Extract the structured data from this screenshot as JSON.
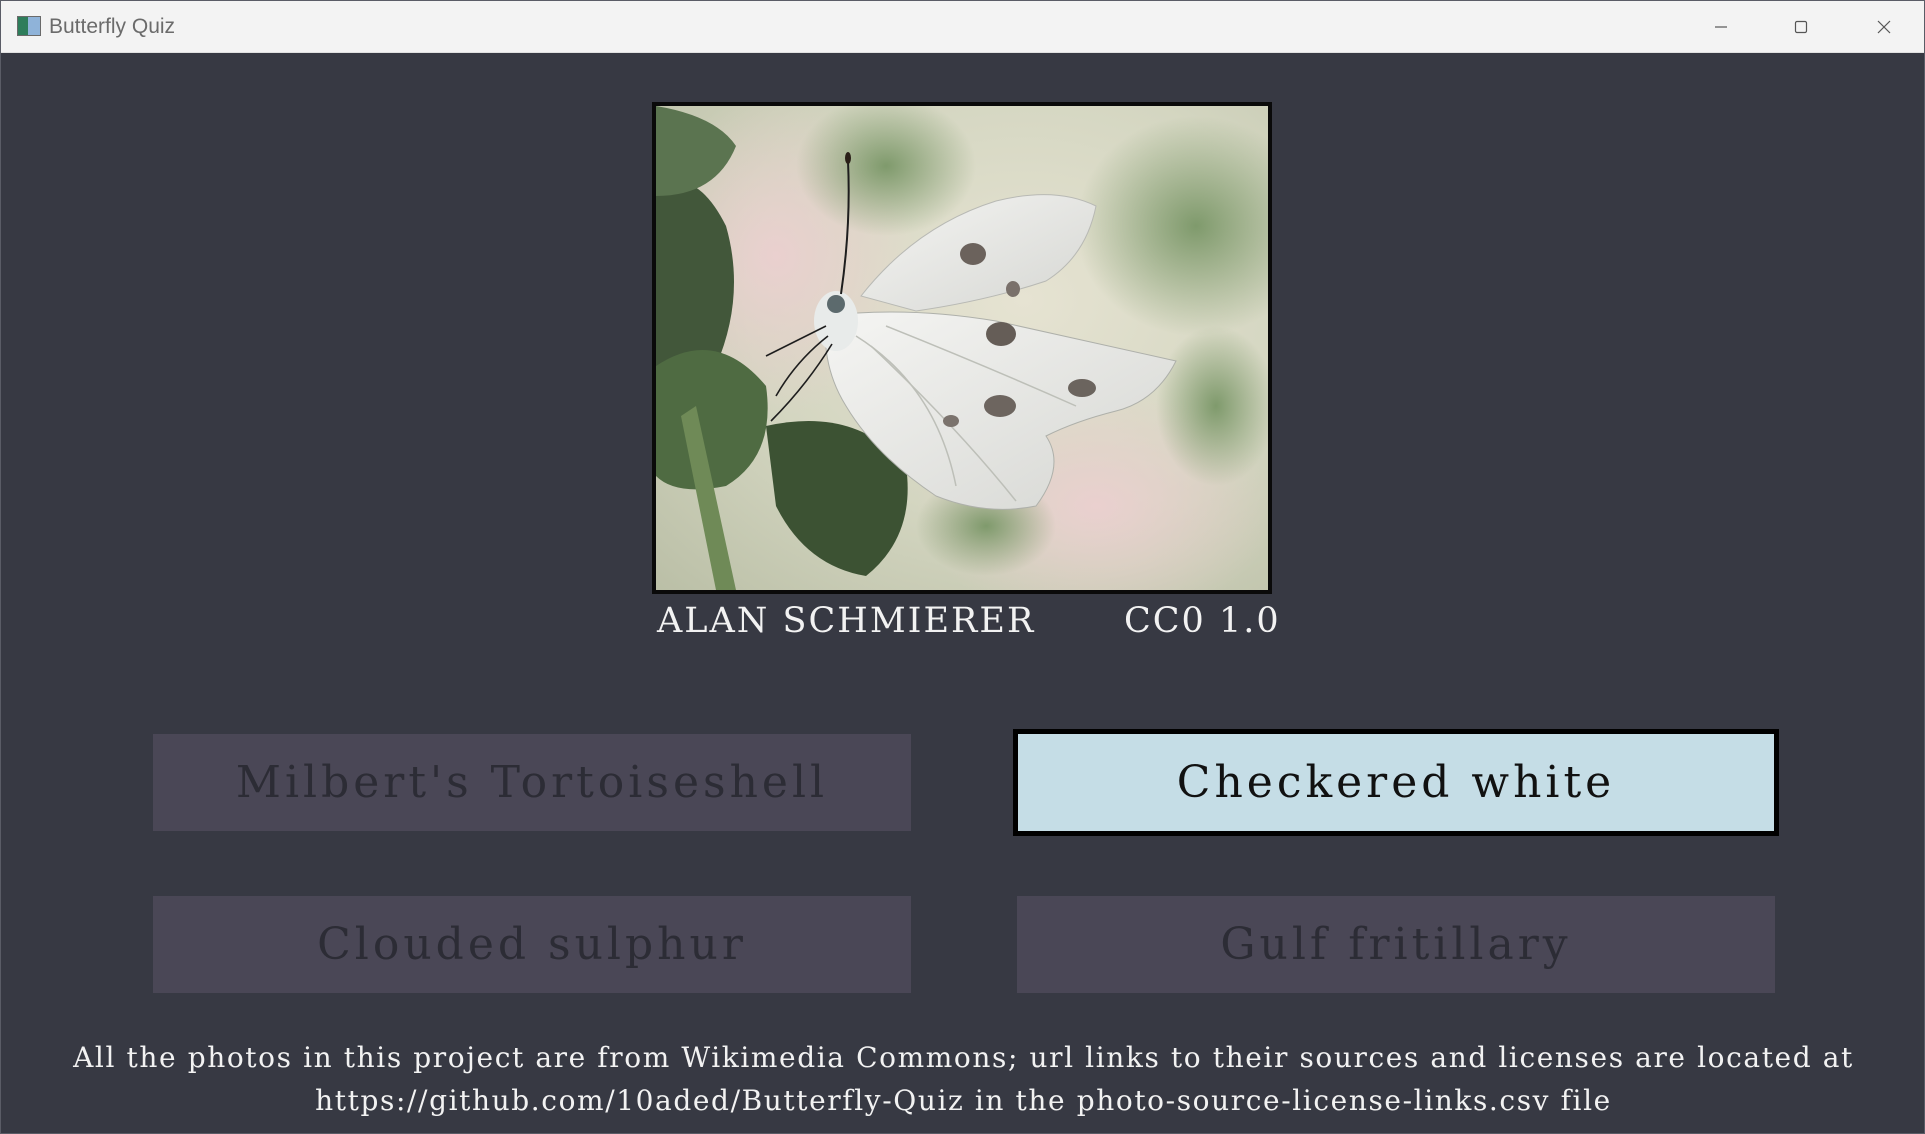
{
  "window": {
    "title": "Butterfly Quiz",
    "icons": [
      "app-icon",
      "minimize-icon",
      "maximize-icon",
      "close-icon"
    ]
  },
  "photo": {
    "subject_icon": "butterfly-photo",
    "credit_author": "ALAN SCHMIERER",
    "credit_license": "CC0 1.0"
  },
  "answers": [
    {
      "label": "Milbert's Tortoiseshell",
      "selected": false
    },
    {
      "label": "Checkered white",
      "selected": true
    },
    {
      "label": "Clouded sulphur",
      "selected": false
    },
    {
      "label": "Gulf fritillary",
      "selected": false
    }
  ],
  "footer": {
    "line1": "All the photos in this project are from Wikimedia Commons; url links to their sources and licenses are located at",
    "line2": "https://github.com/10aded/Butterfly-Quiz in the photo-source-license-links.csv file"
  },
  "colors": {
    "background": "#373943",
    "answer_default": "#4a4756",
    "answer_selected": "#c5dde6"
  }
}
